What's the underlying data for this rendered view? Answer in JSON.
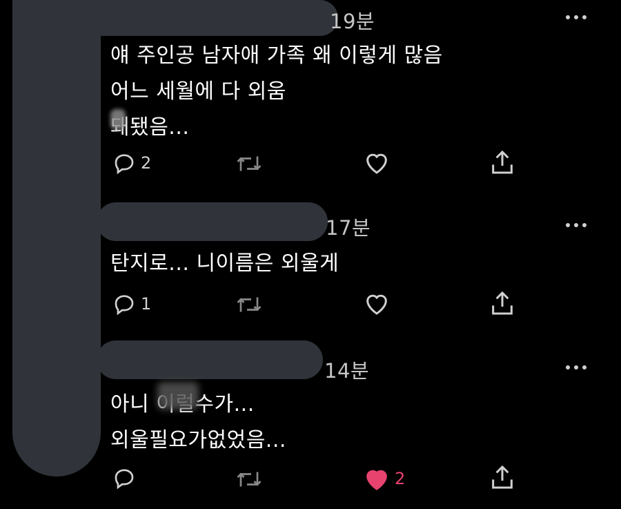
{
  "colors": {
    "background": "#000000",
    "text": "#ffffff",
    "icon": "#d0d0d0",
    "like_active": "#e8436f"
  },
  "tweets": [
    {
      "time": "19분",
      "lines": [
        "얘 주인공 남자애 가족 왜 이렇게 많음",
        "어느 세월에 다 외움",
        "돼됐음..."
      ],
      "reply_count": "2",
      "retweet_count": "",
      "like_count": "",
      "liked": false
    },
    {
      "time": "17분",
      "lines": [
        "탄지로... 니이름은 외울게"
      ],
      "reply_count": "1",
      "retweet_count": "",
      "like_count": "",
      "liked": false
    },
    {
      "time": "14분",
      "lines": [
        "아니 이럴수가...",
        "외울필요가없었음..."
      ],
      "reply_count": "",
      "retweet_count": "",
      "like_count": "2",
      "liked": true
    }
  ],
  "icons": {
    "reply": "reply-icon",
    "retweet": "retweet-icon",
    "like": "heart-icon",
    "share": "share-icon",
    "more": "more-icon"
  }
}
